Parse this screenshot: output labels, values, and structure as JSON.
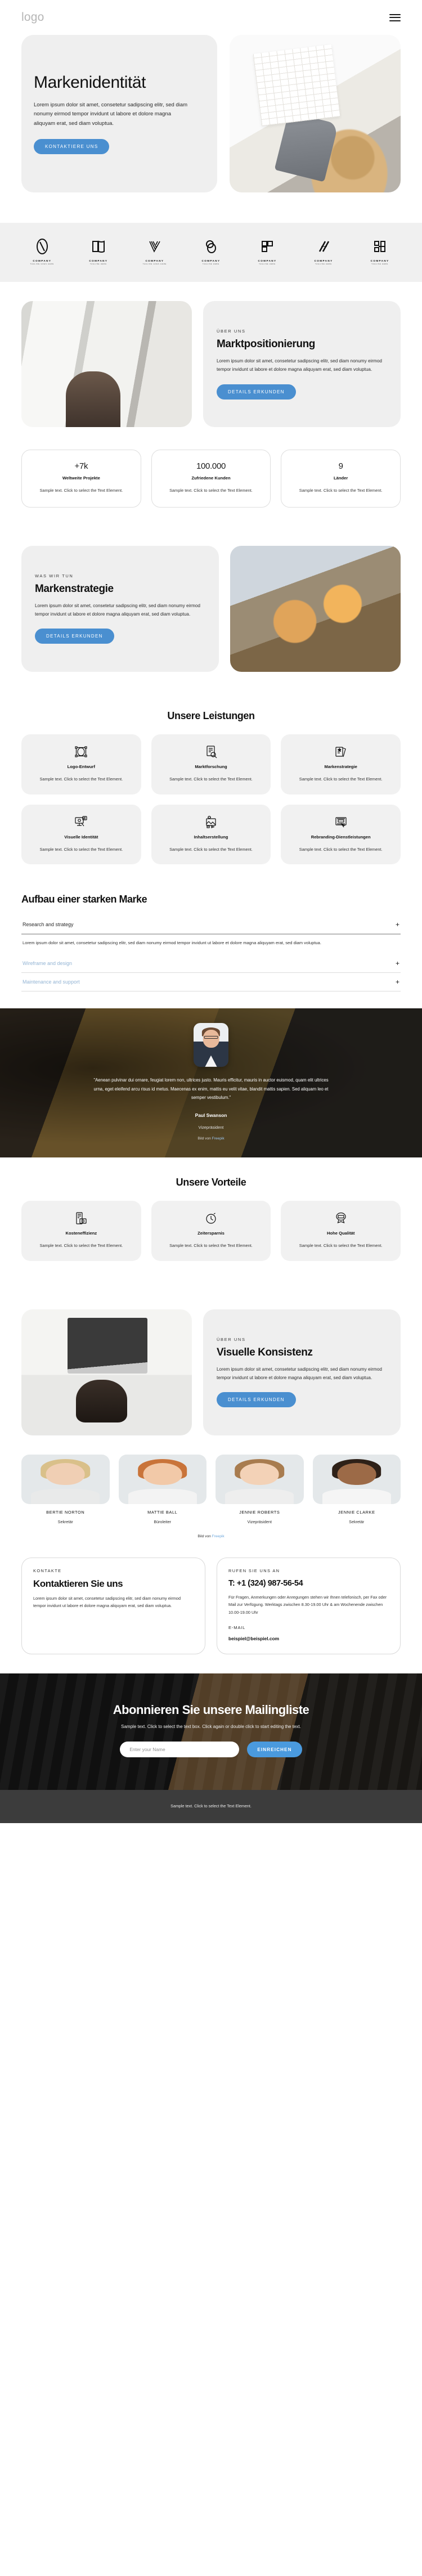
{
  "header": {
    "logo": "logo",
    "menu_icon": "hamburger-menu-icon"
  },
  "hero": {
    "title": "Markenidentität",
    "description": "Lorem ipsum dolor sit amet, consetetur sadipscing elitr, sed diam nonumy eirmod tempor invidunt ut labore et dolore magna aliquyam erat, sed diam voluptua.",
    "cta": "KONTAKTIERE UNS"
  },
  "partners": [
    {
      "name": "COMPANY",
      "tagline": "TAGLINE GOES HERE"
    },
    {
      "name": "COMPANY",
      "tagline": "TAGLINE HERE"
    },
    {
      "name": "COMPANY",
      "tagline": "TAGLINE GOES HERE"
    },
    {
      "name": "COMPANY",
      "tagline": "TAGLINE HERE"
    },
    {
      "name": "COMPANY",
      "tagline": "TAGLINE HERE"
    },
    {
      "name": "COMPANY",
      "tagline": "TAGLINE HERE"
    },
    {
      "name": "COMPANY",
      "tagline": "TAGLINE HERE"
    }
  ],
  "about": {
    "eyebrow": "ÜBER UNS",
    "title": "Marktpositionierung",
    "body": "Lorem ipsum dolor sit amet, consetetur sadipscing elitr, sed diam nonumy eirmod tempor invidunt ut labore et dolore magna aliquyam erat, sed diam voluptua.",
    "cta": "DETAILS ERKUNDEN"
  },
  "stats": [
    {
      "number": "+7k",
      "label": "Weltweite Projekte",
      "text": "Sample text. Click to select the Text Element."
    },
    {
      "number": "100.000",
      "label": "Zufriedene Kunden",
      "text": "Sample text. Click to select the Text Element."
    },
    {
      "number": "9",
      "label": "Länder",
      "text": "Sample text. Click to select the Text Element."
    }
  ],
  "strategy": {
    "eyebrow": "WAS WIR TUN",
    "title": "Markenstrategie",
    "body": "Lorem ipsum dolor sit amet, consetetur sadipscing elitr, sed diam nonumy eirmod tempor invidunt ut labore et dolore magna aliquyam erat, sed diam voluptua.",
    "cta": "DETAILS ERKUNDEN"
  },
  "services": {
    "heading": "Unsere Leistungen",
    "items": [
      {
        "icon": "logo-design-icon",
        "title": "Logo-Entwurf",
        "text": "Sample text. Click to select the Text Element."
      },
      {
        "icon": "market-research-icon",
        "title": "Marktforschung",
        "text": "Sample text. Click to select the Text Element."
      },
      {
        "icon": "brand-strategy-icon",
        "title": "Markenstrategie",
        "text": "Sample text. Click to select the Text Element."
      },
      {
        "icon": "visual-identity-icon",
        "title": "Visuelle Identität",
        "text": "Sample text. Click to select the Text Element."
      },
      {
        "icon": "content-creation-icon",
        "title": "Inhaltserstellung",
        "text": "Sample text. Click to select the Text Element."
      },
      {
        "icon": "rebranding-icon",
        "title": "Rebranding-Dienstleistungen",
        "text": "Sample text. Click to select the Text Element."
      }
    ]
  },
  "accordion": {
    "heading": "Aufbau einer starken Marke",
    "items": [
      {
        "title": "Research and strategy",
        "open": true,
        "body": "Lorem ipsum dolor sit amet, consetetur sadipscing elitr, sed diam nonumy eirmod tempor invidunt ut labore et dolore magna aliquyam erat, sed diam voluptua.",
        "toggle": "+"
      },
      {
        "title": "Wireframe and design",
        "open": false,
        "body": "",
        "toggle": "+"
      },
      {
        "title": "Maintenance and support",
        "open": false,
        "body": "",
        "toggle": "+"
      }
    ]
  },
  "testimonial": {
    "quote": "\"Aenean pulvinar dui ornare, feugiat lorem non, ultrices justo. Mauris efficitur, mauris in auctor euismod, quam elit ultrices urna, eget eleifend arcu risus id metus. Maecenas ex enim, mattis eu velit vitae, blandit mattis sapien. Sed aliquam leo et semper vestibulum.\"",
    "name": "Paul Swanson",
    "role": "Vizepräsident",
    "credit_prefix": "Bild von ",
    "credit_link": "Freepik"
  },
  "benefits": {
    "heading": "Unsere Vorteile",
    "items": [
      {
        "icon": "cost-efficiency-icon",
        "title": "Kosteneffizienz",
        "text": "Sample text. Click to select the Text Element."
      },
      {
        "icon": "clock-icon",
        "title": "Zeitersparnis",
        "text": "Sample text. Click to select the Text Element."
      },
      {
        "icon": "quality-badge-icon",
        "title": "Hohe Qualität",
        "text": "Sample text. Click to select the Text Element."
      }
    ]
  },
  "consistency": {
    "eyebrow": "ÜBER UNS",
    "title": "Visuelle Konsistenz",
    "body": "Lorem ipsum dolor sit amet, consetetur sadipscing elitr, sed diam nonumy eirmod tempor invidunt ut labore et dolore magna aliquyam erat, sed diam voluptua.",
    "cta": "DETAILS ERKUNDEN"
  },
  "team": {
    "members": [
      {
        "name": "BERTIE NORTON",
        "role": "Sekretär"
      },
      {
        "name": "MATTIE BALL",
        "role": "Büroleiter"
      },
      {
        "name": "JENNIE ROBERTS",
        "role": "Vizepräsident"
      },
      {
        "name": "JENNIE CLARKE",
        "role": "Sekretär"
      }
    ],
    "credit_prefix": "Bild von ",
    "credit_link": "Freepik"
  },
  "contact": {
    "left": {
      "eyebrow": "KONTAKTE",
      "title": "Kontaktieren Sie uns",
      "body": "Lorem ipsum dolor sit amet, consetetur sadipscing elitr, sed diam nonumy eirmod tempor invidunt ut labore et dolore magna aliquyam erat, sed diam voluptua."
    },
    "right": {
      "eyebrow": "RUFEN SIE UNS AN",
      "phone": "T: +1 (324) 987-56-54",
      "hours": "Für Fragen, Anmerkungen oder Anregungen stehen wir Ihnen telefonisch, per Fax oder Mail zur Verfügung. Werktags zwischen 8.30-19.00 Uhr & am Wochenende zwischen 10.00-19.00 Uhr",
      "email_label": "E-MAIL",
      "email": "beispiel@beispiel.com"
    }
  },
  "newsletter": {
    "heading": "Abonnieren Sie unsere Mailingliste",
    "subtitle": "Sample text. Click to select the text box. Click again or double click to start editing the text.",
    "placeholder": "Enter your Name",
    "submit": "EINREICHEN"
  },
  "footer": {
    "text": "Sample text. Click to select the Text Element."
  },
  "colors": {
    "accent": "#4a8fd0",
    "accent_alt": "#4a9ade",
    "card_bg": "#efefef",
    "footer_bg": "#3c3c3c"
  }
}
